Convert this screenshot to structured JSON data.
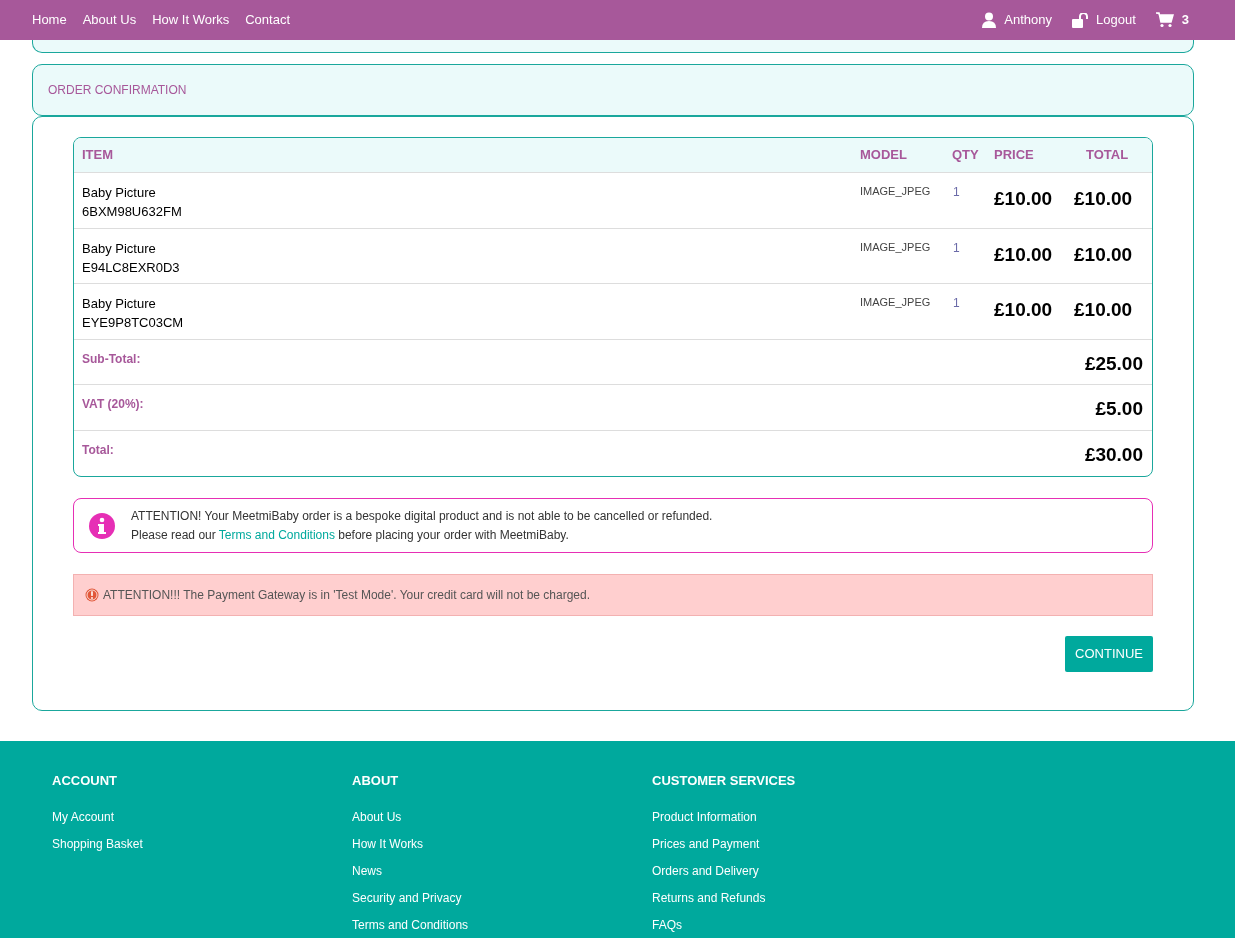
{
  "nav": {
    "links": [
      "Home",
      "About Us",
      "How It Works",
      "Contact"
    ],
    "user": "Anthony",
    "logout": "Logout",
    "cart_count": "3"
  },
  "section_title": "ORDER CONFIRMATION",
  "table": {
    "columns": [
      "ITEM",
      "MODEL",
      "QTY",
      "PRICE",
      "TOTAL"
    ],
    "rows": [
      {
        "name": "Baby Picture",
        "code": "6BXM98U632FM",
        "model": "IMAGE_JPEG",
        "qty": "1",
        "price": "£10.00",
        "total": "£10.00"
      },
      {
        "name": "Baby Picture",
        "code": "E94LC8EXR0D3",
        "model": "IMAGE_JPEG",
        "qty": "1",
        "price": "£10.00",
        "total": "£10.00"
      },
      {
        "name": "Baby Picture",
        "code": "EYE9P8TC03CM",
        "model": "IMAGE_JPEG",
        "qty": "1",
        "price": "£10.00",
        "total": "£10.00"
      }
    ],
    "totals": [
      {
        "label": "Sub-Total:",
        "value": "£25.00"
      },
      {
        "label": "VAT (20%):",
        "value": "£5.00"
      },
      {
        "label": "Total:",
        "value": "£30.00"
      }
    ]
  },
  "info": {
    "line1": "ATTENTION! Your MeetmiBaby order is a bespoke digital product and is not able to be cancelled or refunded.",
    "line2_before": "Please read our",
    "link": "Terms and Conditions",
    "line2_after": "before placing your order with MeetmiBaby."
  },
  "alert": "ATTENTION!!! The Payment Gateway is in 'Test Mode'. Your credit card will not be charged.",
  "button": "CONTINUE",
  "footer": [
    {
      "heading": "ACCOUNT",
      "links": [
        "My Account",
        "Shopping Basket"
      ]
    },
    {
      "heading": "ABOUT",
      "links": [
        "About Us",
        "How It Works",
        "News",
        "Security and Privacy",
        "Terms and Conditions"
      ]
    },
    {
      "heading": "CUSTOMER SERVICES",
      "links": [
        "Product Information",
        "Prices and Payment",
        "Orders and Delivery",
        "Returns and Refunds",
        "FAQs"
      ]
    }
  ]
}
